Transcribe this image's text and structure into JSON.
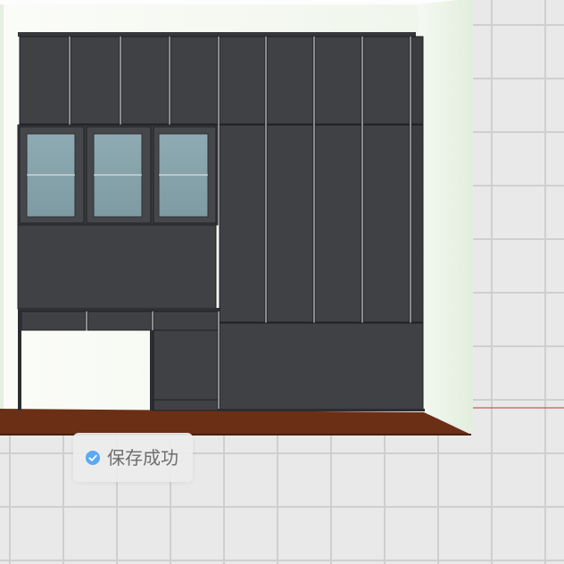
{
  "toast": {
    "message": "保存成功",
    "icon": "check-circle-icon",
    "icon_color": "#5aa8f5"
  },
  "scene": {
    "floor_grid_color": "#cfcfcf",
    "floor_tile_color": "#e9e9e9",
    "wall_color": "#f4f8f0",
    "cabinet_color": "#3f4145",
    "glass_color": "#84a2aa",
    "wood_floor_color": "#6b2f16",
    "accent_line_color": "#c0392b"
  }
}
